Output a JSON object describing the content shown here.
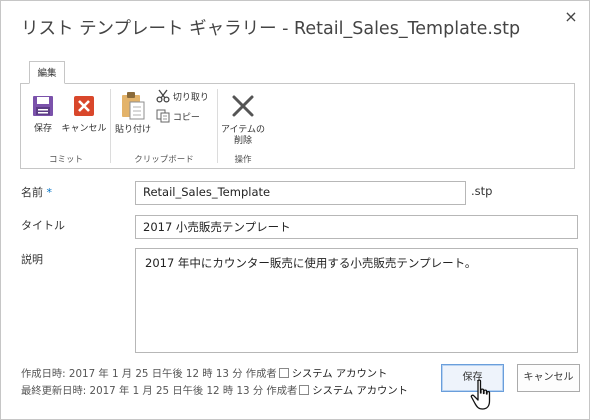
{
  "dialog": {
    "title": "リスト テンプレート ギャラリー - Retail_Sales_Template.stp",
    "close_glyph": "×"
  },
  "ribbon": {
    "tab_label": "編集",
    "groups": [
      {
        "label": "コミット",
        "buttons": [
          {
            "label": "保存"
          },
          {
            "label": "キャンセル"
          }
        ]
      },
      {
        "label": "クリップボード",
        "buttons": [
          {
            "label": "貼り付け"
          },
          {
            "label": "切り取り"
          },
          {
            "label": "コピー"
          }
        ]
      },
      {
        "label": "操作",
        "buttons": [
          {
            "label_line1": "アイテムの",
            "label_line2": "削除"
          }
        ]
      }
    ]
  },
  "form": {
    "name": {
      "label": "名前",
      "required_marker": "*",
      "value": "Retail_Sales_Template",
      "suffix": ".stp"
    },
    "title": {
      "label": "タイトル",
      "value": "2017 小売販売テンプレート"
    },
    "description": {
      "label": "説明",
      "value": "2017 年中にカウンター販売に使用する小売販売テンプレート。"
    }
  },
  "meta": {
    "created": {
      "prefix": "作成日時: 2017 年 1 月 25 日午後 12 時 13 分  作成者",
      "user": "システム アカウント"
    },
    "modified": {
      "prefix": "最終更新日時: 2017 年 1 月 25 日午後 12 時 13 分  作成者",
      "user": "システム アカウント"
    }
  },
  "buttons": {
    "save": "保存",
    "cancel": "キャンセル"
  },
  "colors": {
    "save_icon": "#7b52ab",
    "cancel_icon": "#d9472b",
    "delete_icon": "#555555",
    "required": "#0072c6"
  }
}
